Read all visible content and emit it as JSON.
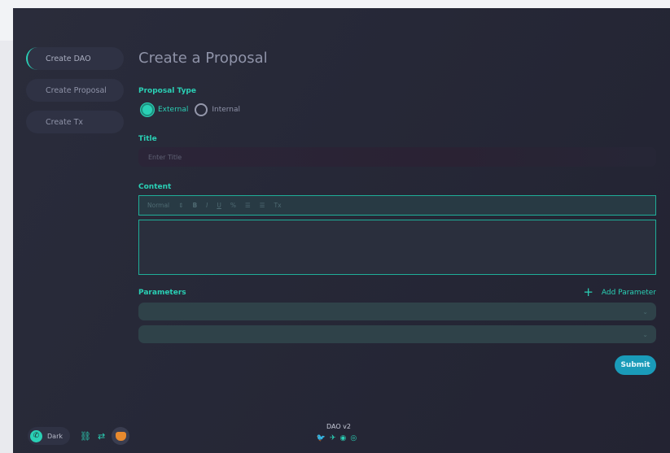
{
  "sidebar": {
    "items": [
      {
        "label": "Create DAO"
      },
      {
        "label": "Create Proposal"
      },
      {
        "label": "Create Tx"
      }
    ]
  },
  "main": {
    "title": "Create a Proposal",
    "proposal_type": {
      "label": "Proposal Type",
      "options": [
        {
          "label": "External",
          "selected": true
        },
        {
          "label": "Internal",
          "selected": false
        }
      ]
    },
    "title_field": {
      "label": "Title",
      "placeholder": "Enter Title",
      "value": ""
    },
    "content": {
      "label": "Content",
      "toolbar": {
        "format": "Normal",
        "format_arrow": "⇕",
        "bold": "B",
        "italic": "I",
        "underline": "U",
        "link": "%",
        "ordered_list": "☰",
        "bullet_list": "☰",
        "clear": "Tx"
      }
    },
    "parameters": {
      "label": "Parameters",
      "add_label": "Add Parameter",
      "add_icon": "+",
      "rows": [
        {
          "value": ""
        },
        {
          "value": ""
        }
      ],
      "chevron": "⌄"
    },
    "submit_label": "Submit"
  },
  "bottom": {
    "theme_label": "Dark",
    "theme_icon": "✆",
    "link_icon": "⛓",
    "swap_icon": "⇄"
  },
  "footer": {
    "version": "DAO v2",
    "socials": [
      "twitter-icon",
      "telegram-icon",
      "reddit-icon",
      "discord-icon"
    ],
    "social_glyphs": "🐦✈◉◎"
  },
  "colors": {
    "accent": "#2ad0b5",
    "submit": "#1a9bb9",
    "background": "#262837"
  }
}
